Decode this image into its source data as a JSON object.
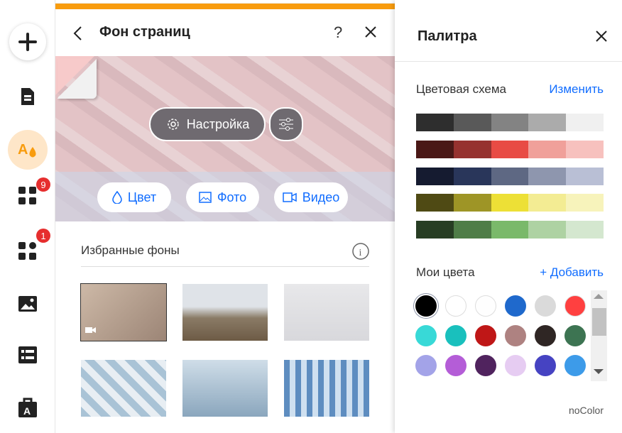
{
  "sidebar": {
    "apps_badge": "9",
    "plugins_badge": "1"
  },
  "panel": {
    "title": "Фон страниц",
    "help": "?",
    "settings_label": "Настройка",
    "color_label": "Цвет",
    "photo_label": "Фото",
    "video_label": "Видео",
    "favorites_title": "Избранные фоны"
  },
  "thumbnails": [
    {
      "name": "shadow-video",
      "bg": "linear-gradient(135deg,#cdb9a7,#9c8576)"
    },
    {
      "name": "mountain-cabin",
      "bg": "linear-gradient(180deg,#dfe3e8 0 40%,#8a7b66 60%,#6d5b45)"
    },
    {
      "name": "yoga-pose",
      "bg": "linear-gradient(180deg,#e8e8ea,#d8d8dc)"
    },
    {
      "name": "milk-glasses",
      "bg": "repeating-linear-gradient(45deg,#a9c3d6 0 10px,#e8eef3 10px 20px)"
    },
    {
      "name": "dancer",
      "bg": "linear-gradient(180deg,#cfdde8,#8aa6bd)"
    },
    {
      "name": "glass-building",
      "bg": "repeating-linear-gradient(90deg,#5e8dc0 0 8px,#cfe0f0 8px 16px)"
    }
  ],
  "palette": {
    "title": "Палитра",
    "scheme_label": "Цветовая схема",
    "change_link": "Изменить",
    "my_colors_label": "Мои цвета",
    "add_link": "+ Добавить",
    "no_color": "noColor",
    "scheme": [
      [
        "#2e2e2e",
        "#595959",
        "#838383",
        "#ababab",
        "#f0f0f0"
      ],
      [
        "#4a1816",
        "#96322f",
        "#e84b44",
        "#f0a09a",
        "#f7c1be"
      ],
      [
        "#151b30",
        "#29365a",
        "#5e6883",
        "#8e96ae",
        "#b9bfd5"
      ],
      [
        "#4f4a14",
        "#9e9526",
        "#ede036",
        "#f3ec93",
        "#f7f3bb"
      ],
      [
        "#273d23",
        "#4f7d47",
        "#7ab96a",
        "#aed2a3",
        "#d4e7cf"
      ]
    ],
    "colors": [
      "#000000",
      "#ffffff",
      "#fefefe",
      "#1f69cc",
      "#dadada",
      "#ff4040",
      "#38d9d7",
      "#19c0bd",
      "#bf1717",
      "#ae8281",
      "#2f2624",
      "#3d7452",
      "#a3a3e8",
      "#b45dd7",
      "#50235e",
      "#e6ccf2",
      "#4643c2",
      "#3d9be9"
    ]
  }
}
